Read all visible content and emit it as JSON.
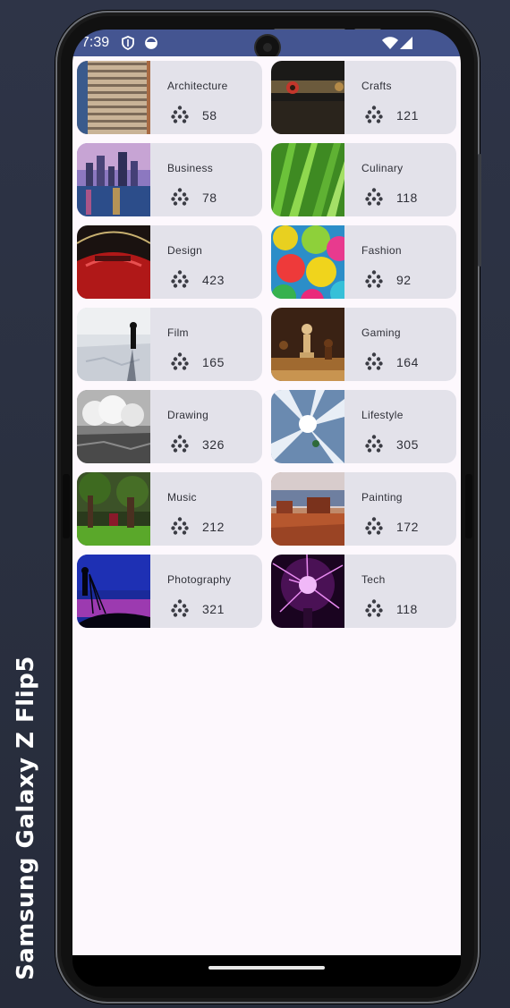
{
  "device": {
    "label": "Samsung Galaxy Z Flip5"
  },
  "status_bar": {
    "time": "7:39",
    "left_icons": [
      "shield-icon",
      "data-saver-icon"
    ],
    "right_icons": [
      "wifi-icon",
      "cell-signal-icon"
    ]
  },
  "categories": [
    {
      "name": "Architecture",
      "count": "58",
      "thumb": "architecture"
    },
    {
      "name": "Crafts",
      "count": "121",
      "thumb": "crafts"
    },
    {
      "name": "Business",
      "count": "78",
      "thumb": "business"
    },
    {
      "name": "Culinary",
      "count": "118",
      "thumb": "culinary"
    },
    {
      "name": "Design",
      "count": "423",
      "thumb": "design"
    },
    {
      "name": "Fashion",
      "count": "92",
      "thumb": "fashion"
    },
    {
      "name": "Film",
      "count": "165",
      "thumb": "film"
    },
    {
      "name": "Gaming",
      "count": "164",
      "thumb": "gaming"
    },
    {
      "name": "Drawing",
      "count": "326",
      "thumb": "drawing"
    },
    {
      "name": "Lifestyle",
      "count": "305",
      "thumb": "lifestyle"
    },
    {
      "name": "Music",
      "count": "212",
      "thumb": "music"
    },
    {
      "name": "Painting",
      "count": "172",
      "thumb": "painting"
    },
    {
      "name": "Photography",
      "count": "321",
      "thumb": "photography"
    },
    {
      "name": "Tech",
      "count": "118",
      "thumb": "tech"
    }
  ],
  "colors": {
    "status_bar": "#445591",
    "card_bg": "#e3e2ea",
    "app_bg": "#fdf8fd",
    "text": "#2f3038"
  }
}
